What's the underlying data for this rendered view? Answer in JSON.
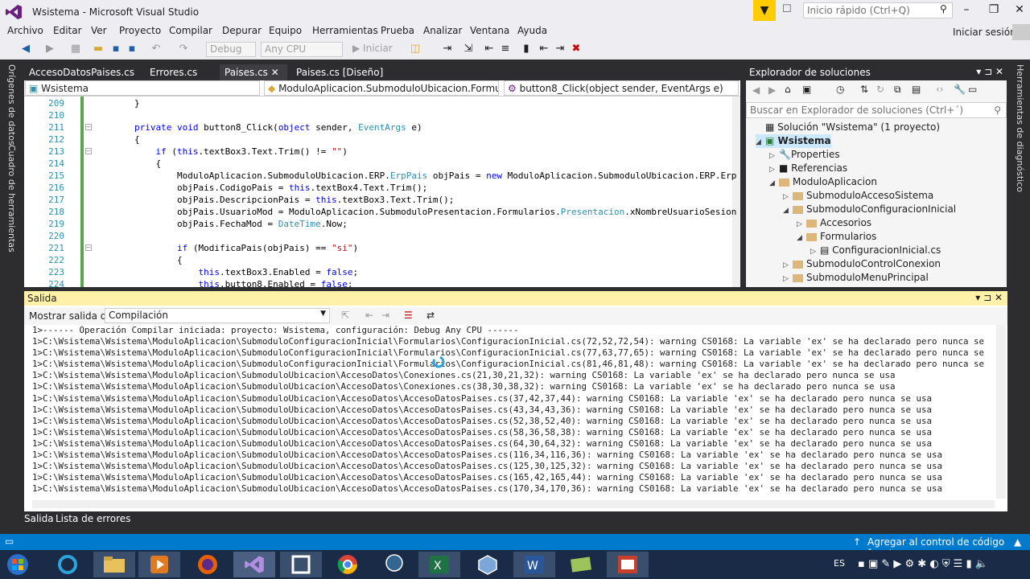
{
  "window": {
    "title": "Wsistema - Microsoft Visual Studio",
    "quick_launch_placeholder": "Inicio rápido (Ctrl+Q)",
    "sign_in": "Iniciar sesión"
  },
  "menu": [
    "Archivo",
    "Editar",
    "Ver",
    "Proyecto",
    "Compilar",
    "Depurar",
    "Equipo",
    "Herramientas",
    "Prueba",
    "Analizar",
    "Ventana",
    "Ayuda"
  ],
  "toolbar": {
    "config": "Debug",
    "platform": "Any CPU",
    "start": "Iniciar"
  },
  "side_rails": {
    "left": [
      "Orígenes de datos",
      "Cuadro de herramientas"
    ],
    "right": [
      "Herramientas de diagnóstico"
    ]
  },
  "doc_tabs": [
    "AccesoDatosPaises.cs",
    "Errores.cs",
    "Paises.cs",
    "Paises.cs [Diseño]"
  ],
  "nav": {
    "project": "Wsistema",
    "type": "ModuloAplicacion.SubmoduloUbicacion.Formulario",
    "member": "button8_Click(object sender, EventArgs e)"
  },
  "code_lines": [
    {
      "n": "209",
      "text": "        }"
    },
    {
      "n": "210",
      "text": ""
    },
    {
      "n": "211",
      "text": "        private void button8_Click(object sender, EventArgs e)"
    },
    {
      "n": "212",
      "text": "        {"
    },
    {
      "n": "213",
      "text": "            if (this.textBox3.Text.Trim() != \"\")"
    },
    {
      "n": "214",
      "text": "            {"
    },
    {
      "n": "215",
      "text": "                ModuloAplicacion.SubmoduloUbicacion.ERP.ErpPais objPais = new ModuloAplicacion.SubmoduloUbicacion.ERP.Erp"
    },
    {
      "n": "216",
      "text": "                objPais.CodigoPais = this.textBox4.Text.Trim();"
    },
    {
      "n": "217",
      "text": "                objPais.DescripcionPais = this.textBox3.Text.Trim();"
    },
    {
      "n": "218",
      "text": "                objPais.UsuarioMod = ModuloAplicacion.SubmoduloPresentacion.Formularios.Presentacion.xNombreUsuarioSesion"
    },
    {
      "n": "219",
      "text": "                objPais.FechaMod = DateTime.Now;"
    },
    {
      "n": "220",
      "text": ""
    },
    {
      "n": "221",
      "text": "                if (ModificaPais(objPais) == \"si\")"
    },
    {
      "n": "222",
      "text": "                {"
    },
    {
      "n": "223",
      "text": "                    this.textBox3.Enabled = false;"
    },
    {
      "n": "224",
      "text": "                    this.button8.Enabled = false;"
    }
  ],
  "solution_explorer": {
    "title": "Explorador de soluciones",
    "search_placeholder": "Buscar en Explorador de soluciones (Ctrl+´)",
    "tree": [
      {
        "label": "Solución \"Wsistema\" (1 proyecto)"
      },
      {
        "label": "Wsistema"
      },
      {
        "label": "Properties"
      },
      {
        "label": "Referencias"
      },
      {
        "label": "ModuloAplicacion"
      },
      {
        "label": "SubmoduloAccesoSistema"
      },
      {
        "label": "SubmoduloConfiguracionInicial"
      },
      {
        "label": "Accesorios"
      },
      {
        "label": "Formularios"
      },
      {
        "label": "ConfiguracionInicial.cs"
      },
      {
        "label": "SubmoduloControlConexion"
      },
      {
        "label": "SubmoduloMenuPrincipal"
      }
    ]
  },
  "output": {
    "title": "Salida",
    "show_from_label": "Mostrar salida de:",
    "source": "Compilación",
    "lines": [
      "1>------ Operación Compilar iniciada: proyecto: Wsistema, configuración: Debug Any CPU ------",
      "1>C:\\Wsistema\\Wsistema\\ModuloAplicacion\\SubmoduloConfiguracionInicial\\Formularios\\ConfiguracionInicial.cs(72,52,72,54): warning CS0168: La variable 'ex' se ha declarado pero nunca se",
      "1>C:\\Wsistema\\Wsistema\\ModuloAplicacion\\SubmoduloConfiguracionInicial\\Formularios\\ConfiguracionInicial.cs(77,63,77,65): warning CS0168: La variable 'ex' se ha declarado pero nunca se",
      "1>C:\\Wsistema\\Wsistema\\ModuloAplicacion\\SubmoduloConfiguracionInicial\\Formularios\\ConfiguracionInicial.cs(81,46,81,48): warning CS0168: La variable 'ex' se ha declarado pero nunca se",
      "1>C:\\Wsistema\\Wsistema\\ModuloAplicacion\\SubmoduloUbicacion\\AccesoDatos\\Conexiones.cs(21,30,21,32): warning CS0168: La variable 'ex' se ha declarado pero nunca se usa",
      "1>C:\\Wsistema\\Wsistema\\ModuloAplicacion\\SubmoduloUbicacion\\AccesoDatos\\Conexiones.cs(38,30,38,32): warning CS0168: La variable 'ex' se ha declarado pero nunca se usa",
      "1>C:\\Wsistema\\Wsistema\\ModuloAplicacion\\SubmoduloUbicacion\\AccesoDatos\\AccesoDatosPaises.cs(37,42,37,44): warning CS0168: La variable 'ex' se ha declarado pero nunca se usa",
      "1>C:\\Wsistema\\Wsistema\\ModuloAplicacion\\SubmoduloUbicacion\\AccesoDatos\\AccesoDatosPaises.cs(43,34,43,36): warning CS0168: La variable 'ex' se ha declarado pero nunca se usa",
      "1>C:\\Wsistema\\Wsistema\\ModuloAplicacion\\SubmoduloUbicacion\\AccesoDatos\\AccesoDatosPaises.cs(52,38,52,40): warning CS0168: La variable 'ex' se ha declarado pero nunca se usa",
      "1>C:\\Wsistema\\Wsistema\\ModuloAplicacion\\SubmoduloUbicacion\\AccesoDatos\\AccesoDatosPaises.cs(58,36,58,38): warning CS0168: La variable 'ex' se ha declarado pero nunca se usa",
      "1>C:\\Wsistema\\Wsistema\\ModuloAplicacion\\SubmoduloUbicacion\\AccesoDatos\\AccesoDatosPaises.cs(64,30,64,32): warning CS0168: La variable 'ex' se ha declarado pero nunca se usa",
      "1>C:\\Wsistema\\Wsistema\\ModuloAplicacion\\SubmoduloUbicacion\\AccesoDatos\\AccesoDatosPaises.cs(116,34,116,36): warning CS0168: La variable 'ex' se ha declarado pero nunca se usa",
      "1>C:\\Wsistema\\Wsistema\\ModuloAplicacion\\SubmoduloUbicacion\\AccesoDatos\\AccesoDatosPaises.cs(125,30,125,32): warning CS0168: La variable 'ex' se ha declarado pero nunca se usa",
      "1>C:\\Wsistema\\Wsistema\\ModuloAplicacion\\SubmoduloUbicacion\\AccesoDatos\\AccesoDatosPaises.cs(165,42,165,44): warning CS0168: La variable 'ex' se ha declarado pero nunca se usa",
      "1>C:\\Wsistema\\Wsistema\\ModuloAplicacion\\SubmoduloUbicacion\\AccesoDatos\\AccesoDatosPaises.cs(170,34,170,36): warning CS0168: La variable 'ex' se ha declarado pero nunca se usa"
    ]
  },
  "bottom_tabs": [
    "Salida",
    "Lista de errores"
  ],
  "status_bar": {
    "source_control": "Agregar al control de código fuente"
  },
  "taskbar": {
    "lang": "ES"
  },
  "colors": {
    "accent": "#007acc",
    "vs_purple": "#68217a",
    "output_header": "#fff1a8"
  }
}
